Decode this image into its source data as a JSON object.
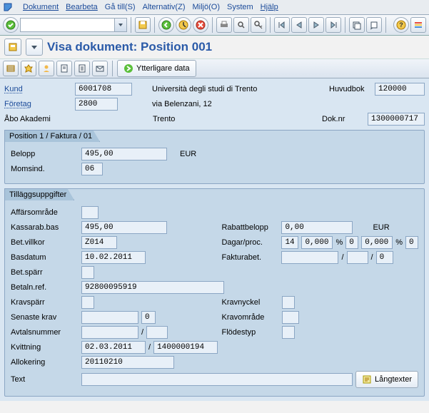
{
  "menu": {
    "dokument": "Dokument",
    "bearbeta": "Bearbeta",
    "ga_till": "Gå till(S)",
    "alternativ": "Alternativ(Z)",
    "miljo": "Miljö(O)",
    "system": "System",
    "hjalp": "Hjälp"
  },
  "title": "Visa dokument: Position 001",
  "app_toolbar": {
    "ytterligare": "Ytterligare data"
  },
  "header": {
    "kund_lbl": "Kund",
    "kund": "6001708",
    "kund_name": "Università degli studi di Trento",
    "huvudbok_lbl": "Huvudbok",
    "huvudbok": "120000",
    "foretag_lbl": "Företag",
    "foretag": "2800",
    "addr": "via Belenzani, 12",
    "org": "Åbo Akademi",
    "city": "Trento",
    "doknr_lbl": "Dok.nr",
    "doknr": "1300000717"
  },
  "position": {
    "group": "Position 1 / Faktura / 01",
    "belopp_lbl": "Belopp",
    "belopp": "495,00",
    "curr": "EUR",
    "momsind_lbl": "Momsind.",
    "momsind": "06"
  },
  "tillagg": {
    "group": "Tilläggsuppgifter",
    "affarsomrade_lbl": "Affärsområde",
    "affarsomrade": "",
    "kassarab_lbl": "Kassarab.bas",
    "kassarab": "495,00",
    "rabattbelopp_lbl": "Rabattbelopp",
    "rabattbelopp": "0,00",
    "rabatt_curr": "EUR",
    "betvillkor_lbl": "Bet.villkor",
    "betvillkor": "Z014",
    "dagar_lbl": "Dagar/proc.",
    "dagar1": "14",
    "proc1": "0,000",
    "pct": "%",
    "dagar2": "0",
    "proc2": "0,000",
    "dagar3": "0",
    "basdatum_lbl": "Basdatum",
    "basdatum": "10.02.2011",
    "fakturabet_lbl": "Fakturabet.",
    "fakturabet_a": "",
    "fakturabet_b": "",
    "fakturabet_c": "0",
    "slash": "/",
    "betsparr_lbl": "Bet.spärr",
    "betsparr": "",
    "betalnref_lbl": "Betaln.ref.",
    "betalnref": "92800095919",
    "kravsparr_lbl": "Kravspärr",
    "kravsparr": "",
    "kravnyckel_lbl": "Kravnyckel",
    "kravnyckel": "",
    "senaste_lbl": "Senaste krav",
    "senaste_a": "",
    "senaste_b": "0",
    "kravomrade_lbl": "Kravområde",
    "kravomrade": "",
    "avtalsnummer_lbl": "Avtalsnummer",
    "avtals_a": "",
    "avtals_b": "",
    "flodestyp_lbl": "Flödestyp",
    "flodestyp": "",
    "kvittning_lbl": "Kvittning",
    "kvittning_a": "02.03.2011",
    "kvittning_b": "1400000194",
    "allokering_lbl": "Allokering",
    "allokering": "20110210",
    "text_lbl": "Text",
    "text": "",
    "langtexter": "Långtexter"
  }
}
